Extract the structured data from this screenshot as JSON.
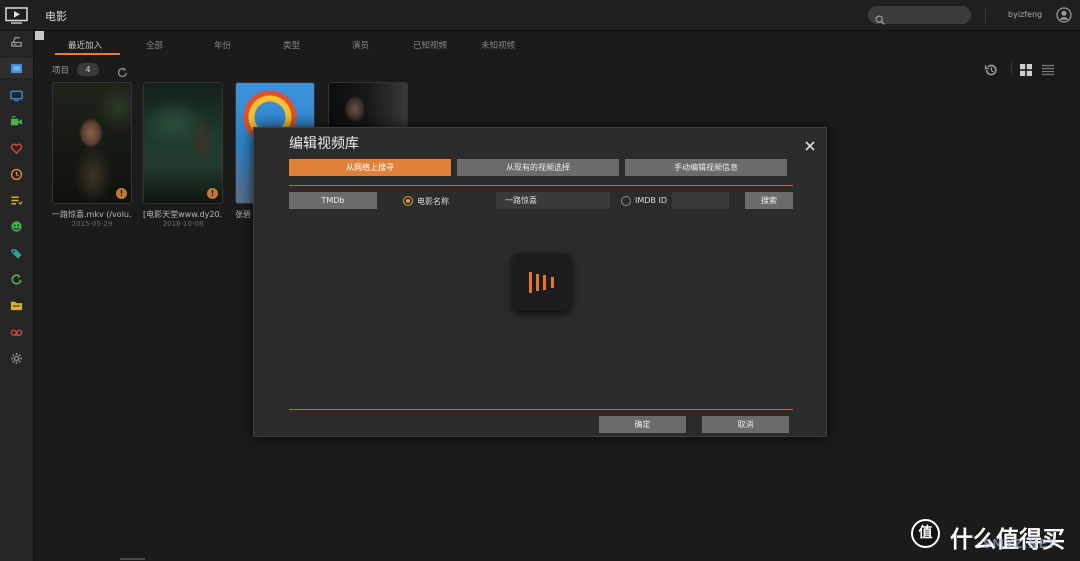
{
  "app": {
    "title": "电影",
    "logo_icon": "video-station-logo-icon"
  },
  "header": {
    "search_icon": "search-icon",
    "search_value": "",
    "username": "byizfeng",
    "avatar_icon": "user-avatar-icon"
  },
  "colors": {
    "accent": "#e0813a",
    "bg": "#1b1b1b",
    "sidebar": "#252525",
    "header": "#1f1f1f",
    "modal": "#2b2b2b",
    "button": "#6b6b6b",
    "input": "#3a3a3a"
  },
  "sidebar": {
    "items": [
      {
        "icon": "video-library-icon",
        "color": "#9a9a9a"
      },
      {
        "icon": "movie-icon",
        "color": "#3d8fd9",
        "active": true
      },
      {
        "icon": "tv-show-icon",
        "color": "#2f86cf"
      },
      {
        "icon": "home-video-icon",
        "color": "#4caf50"
      },
      {
        "icon": "heart-icon",
        "color": "#d9483b"
      },
      {
        "icon": "clock-icon",
        "color": "#e0892e"
      },
      {
        "icon": "watchlist-icon",
        "color": "#d4b234"
      },
      {
        "icon": "shared-icon",
        "color": "#3fae49"
      },
      {
        "icon": "collection-tag-icon",
        "color": "#2aa38a"
      },
      {
        "icon": "sync-icon",
        "color": "#4caf50"
      },
      {
        "icon": "folder-icon",
        "color": "#d4b234"
      },
      {
        "icon": "tv-recording-icon",
        "color": "#d9483b"
      },
      {
        "icon": "gear-icon",
        "color": "#8a8a8a"
      }
    ]
  },
  "tabs": {
    "items": [
      "最近加入",
      "全部",
      "年份",
      "类型",
      "演员",
      "已知视频",
      "未知视频"
    ],
    "active_index": 0
  },
  "toolbar": {
    "items_label": "项目",
    "items_count": 4,
    "refresh_icon": "refresh-icon",
    "history_icon": "history-icon",
    "grid_view_icon": "grid-view-icon",
    "list_view_icon": "list-view-icon",
    "grid_view_active": true
  },
  "videos": [
    {
      "caption": "一路惊喜.mkv (/volu...",
      "date": "2015-05-29",
      "warning_icon": "warning-icon"
    },
    {
      "caption": "[电影天堂www.dy20...",
      "date": "2018-10-08",
      "warning_icon": "warning-icon"
    },
    {
      "caption": "张碧"
    },
    {}
  ],
  "modal": {
    "title": "编辑视频库",
    "close_icon": "close-icon",
    "tabs": [
      "从网络上搜寻",
      "从现有的视频选择",
      "手动编辑视频信息"
    ],
    "active_tab": 0,
    "source_select": "TMDb",
    "title_radio_label": "电影名称",
    "title_radio_selected": true,
    "title_value": "一路惊喜",
    "imdb_radio_label": "IMDB ID",
    "imdb_radio_selected": false,
    "imdb_value": "",
    "search_button": "搜索",
    "loading_icon": "loading-spinner-icon",
    "ok_button": "确定",
    "cancel_button": "取消"
  },
  "watermark": {
    "logo_glyph": "值",
    "text": "什么值得买",
    "overlay": "SMYZ.NET"
  }
}
